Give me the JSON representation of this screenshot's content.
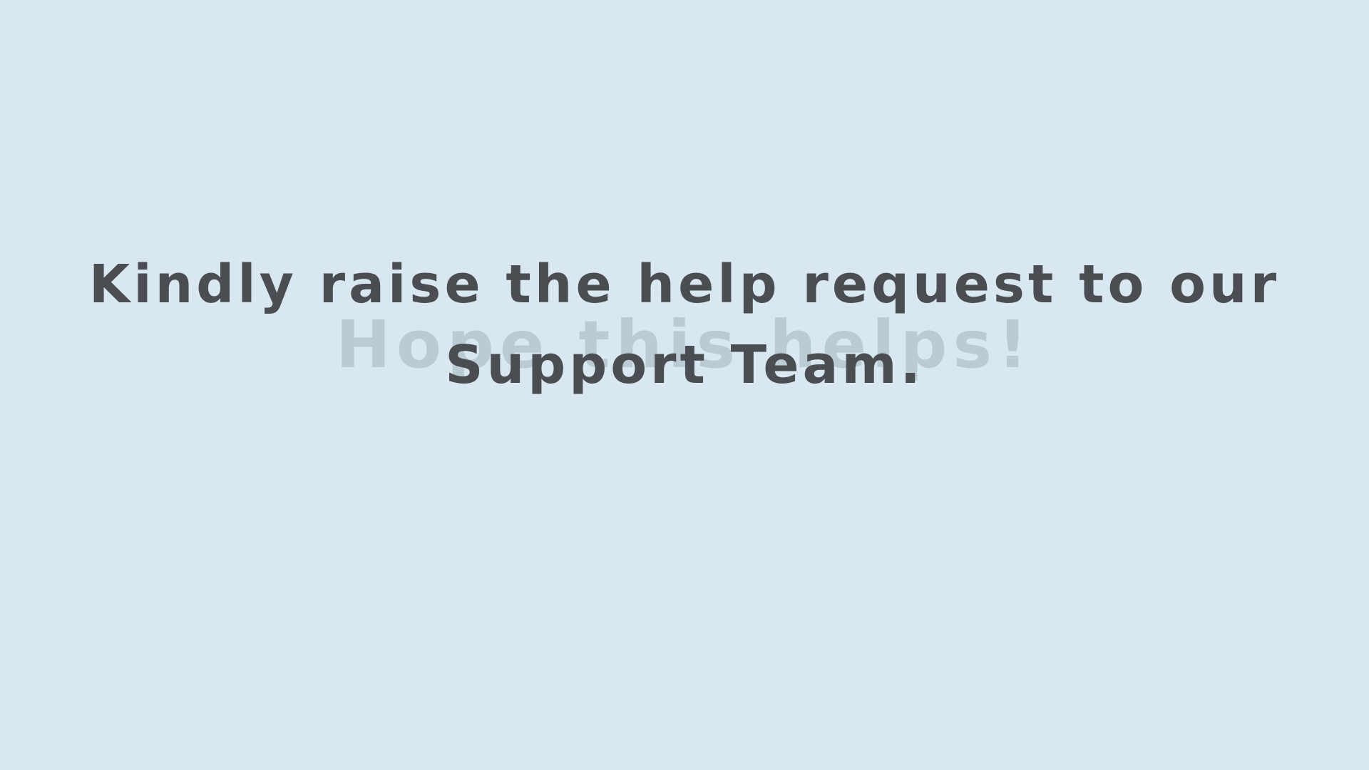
{
  "background_color": "#d8e7f0",
  "text_color": "#4a4d52",
  "ghost_color": "#9aaab3",
  "ghost_text": "Hope this helps!",
  "message": {
    "line1": "Kindly raise the help request to our",
    "line2": "Support Team."
  }
}
